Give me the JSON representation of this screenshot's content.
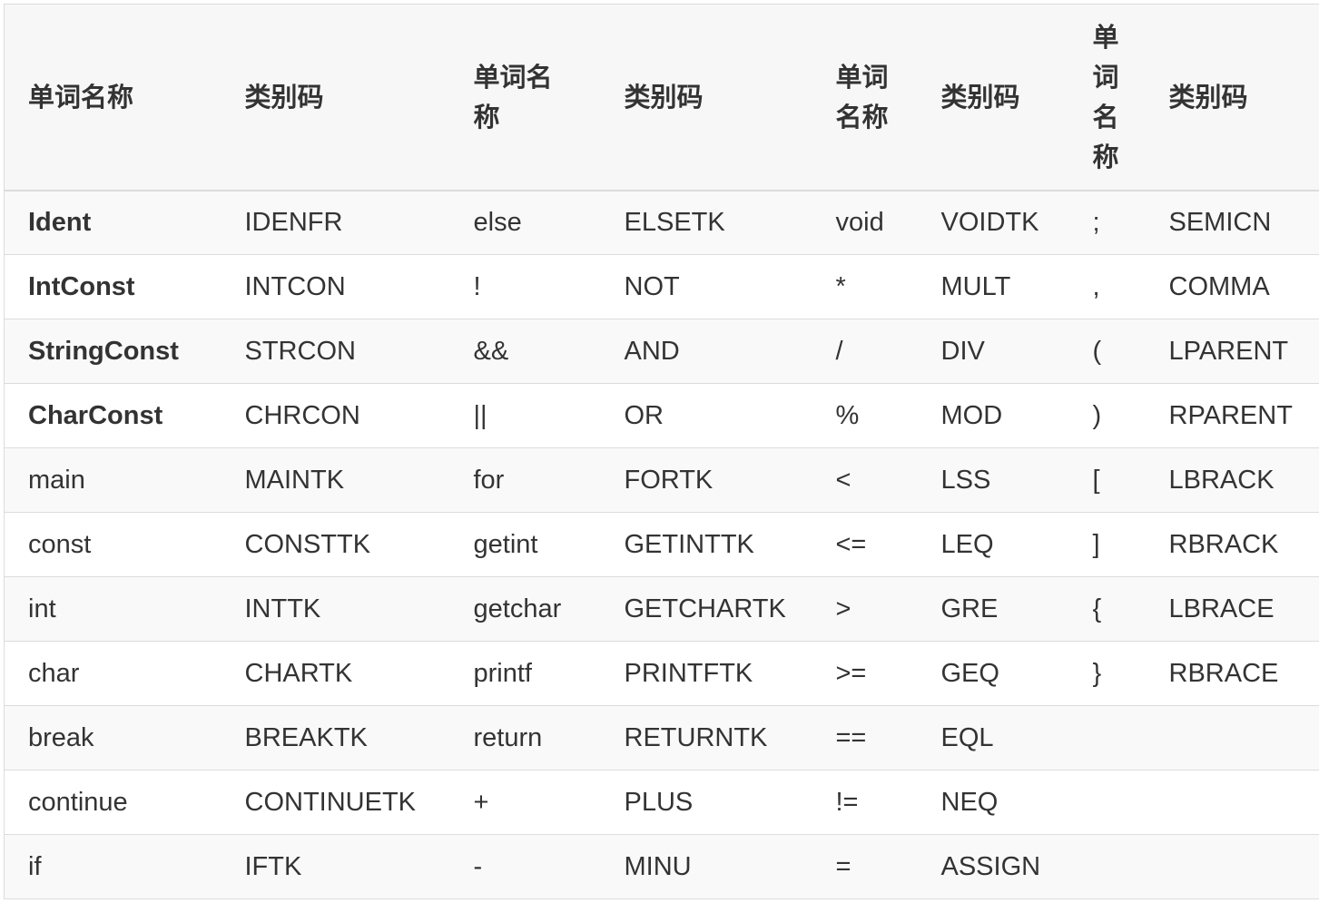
{
  "headers": [
    "单词名称",
    "类别码",
    "单词名称",
    "类别码",
    "单词名称",
    "类别码",
    "单词名称",
    "类别码"
  ],
  "rows": [
    {
      "cells": [
        "Ident",
        "IDENFR",
        "else",
        "ELSETK",
        "void",
        "VOIDTK",
        ";",
        "SEMICN"
      ],
      "bold_first": true
    },
    {
      "cells": [
        "IntConst",
        "INTCON",
        "!",
        "NOT",
        "*",
        "MULT",
        ",",
        "COMMA"
      ],
      "bold_first": true
    },
    {
      "cells": [
        "StringConst",
        "STRCON",
        "&&",
        "AND",
        "/",
        "DIV",
        "(",
        "LPARENT"
      ],
      "bold_first": true
    },
    {
      "cells": [
        "CharConst",
        "CHRCON",
        "||",
        "OR",
        "%",
        "MOD",
        ")",
        "RPARENT"
      ],
      "bold_first": true
    },
    {
      "cells": [
        "main",
        "MAINTK",
        "for",
        "FORTK",
        "<",
        "LSS",
        "[",
        "LBRACK"
      ],
      "bold_first": false
    },
    {
      "cells": [
        "const",
        "CONSTTK",
        "getint",
        "GETINTTK",
        "<=",
        "LEQ",
        "]",
        "RBRACK"
      ],
      "bold_first": false
    },
    {
      "cells": [
        "int",
        "INTTK",
        "getchar",
        "GETCHARTK",
        ">",
        "GRE",
        "{",
        "LBRACE"
      ],
      "bold_first": false
    },
    {
      "cells": [
        "char",
        "CHARTK",
        "printf",
        "PRINTFTK",
        ">=",
        "GEQ",
        "}",
        "RBRACE"
      ],
      "bold_first": false
    },
    {
      "cells": [
        "break",
        "BREAKTK",
        "return",
        "RETURNTK",
        "==",
        "EQL",
        "",
        ""
      ],
      "bold_first": false
    },
    {
      "cells": [
        "continue",
        "CONTINUETK",
        "+",
        "PLUS",
        "!=",
        "NEQ",
        "",
        ""
      ],
      "bold_first": false
    },
    {
      "cells": [
        "if",
        "IFTK",
        "-",
        "MINU",
        "=",
        "ASSIGN",
        "",
        ""
      ],
      "bold_first": false
    }
  ]
}
